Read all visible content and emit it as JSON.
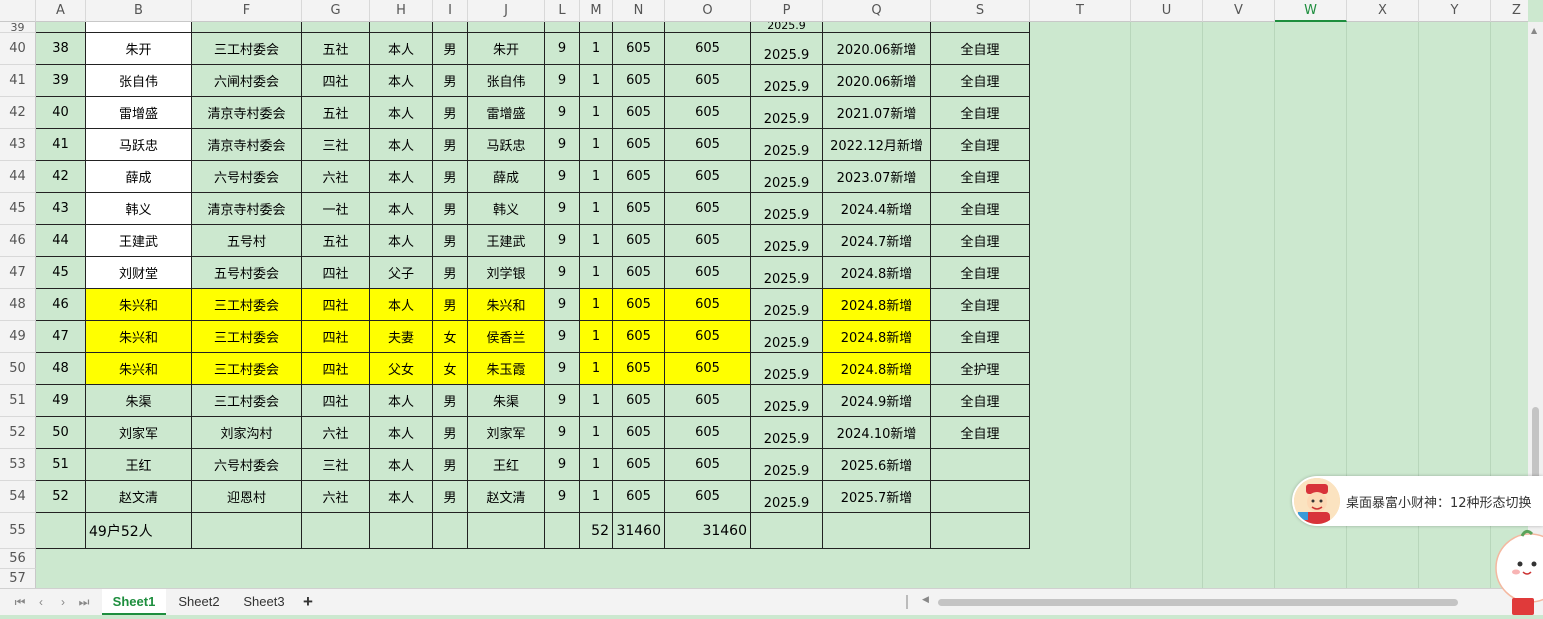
{
  "columns": [
    "A",
    "B",
    "F",
    "G",
    "H",
    "I",
    "J",
    "L",
    "M",
    "N",
    "O",
    "P",
    "Q",
    "S",
    "T",
    "U",
    "V",
    "W",
    "X",
    "Y",
    "Z"
  ],
  "selected_column": "W",
  "rows": [
    {
      "num": "40",
      "a": "38",
      "b": "朱开",
      "f": "三工村委会",
      "g": "五社",
      "h": "本人",
      "i": "男",
      "j": "朱开",
      "l": "9",
      "m": "1",
      "n": "605",
      "o": "605",
      "p": "2025.9",
      "q": "2020.06新增",
      "s": "全自理"
    },
    {
      "num": "41",
      "a": "39",
      "b": "张自伟",
      "f": "六闸村委会",
      "g": "四社",
      "h": "本人",
      "i": "男",
      "j": "张自伟",
      "l": "9",
      "m": "1",
      "n": "605",
      "o": "605",
      "p": "2025.9",
      "q": "2020.06新增",
      "s": "全自理"
    },
    {
      "num": "42",
      "a": "40",
      "b": "雷增盛",
      "f": "清京寺村委会",
      "g": "五社",
      "h": "本人",
      "i": "男",
      "j": "雷增盛",
      "l": "9",
      "m": "1",
      "n": "605",
      "o": "605",
      "p": "2025.9",
      "q": "2021.07新增",
      "s": "全自理"
    },
    {
      "num": "43",
      "a": "41",
      "b": "马跃忠",
      "f": "清京寺村委会",
      "g": "三社",
      "h": "本人",
      "i": "男",
      "j": "马跃忠",
      "l": "9",
      "m": "1",
      "n": "605",
      "o": "605",
      "p": "2025.9",
      "q": "2022.12月新增",
      "s": "全自理"
    },
    {
      "num": "44",
      "a": "42",
      "b": "薛成",
      "f": "六号村委会",
      "g": "六社",
      "h": "本人",
      "i": "男",
      "j": "薛成",
      "l": "9",
      "m": "1",
      "n": "605",
      "o": "605",
      "p": "2025.9",
      "q": "2023.07新增",
      "s": "全自理"
    },
    {
      "num": "45",
      "a": "43",
      "b": "韩义",
      "f": "清京寺村委会",
      "g": "一社",
      "h": "本人",
      "i": "男",
      "j": "韩义",
      "l": "9",
      "m": "1",
      "n": "605",
      "o": "605",
      "p": "2025.9",
      "q": "2024.4新增",
      "s": "全自理"
    },
    {
      "num": "46",
      "a": "44",
      "b": "王建武",
      "f": "五号村",
      "g": "五社",
      "h": "本人",
      "i": "男",
      "j": "王建武",
      "l": "9",
      "m": "1",
      "n": "605",
      "o": "605",
      "p": "2025.9",
      "q": "2024.7新增",
      "s": "全自理"
    },
    {
      "num": "47",
      "a": "45",
      "b": "刘财堂",
      "f": "五号村委会",
      "g": "四社",
      "h": "父子",
      "i": "男",
      "j": "刘学银",
      "l": "9",
      "m": "1",
      "n": "605",
      "o": "605",
      "p": "2025.9",
      "q": "2024.8新增",
      "s": "全自理"
    },
    {
      "num": "48",
      "a": "46",
      "b": "朱兴和",
      "f": "三工村委会",
      "g": "四社",
      "h": "本人",
      "i": "男",
      "j": "朱兴和",
      "l": "9",
      "m": "1",
      "n": "605",
      "o": "605",
      "p": "2025.9",
      "q": "2024.8新增",
      "s": "全自理"
    },
    {
      "num": "49",
      "a": "47",
      "b": "朱兴和",
      "f": "三工村委会",
      "g": "四社",
      "h": "夫妻",
      "i": "女",
      "j": "侯香兰",
      "l": "9",
      "m": "1",
      "n": "605",
      "o": "605",
      "p": "2025.9",
      "q": "2024.8新增",
      "s": "全自理"
    },
    {
      "num": "50",
      "a": "48",
      "b": "朱兴和",
      "f": "三工村委会",
      "g": "四社",
      "h": "父女",
      "i": "女",
      "j": "朱玉霞",
      "l": "9",
      "m": "1",
      "n": "605",
      "o": "605",
      "p": "2025.9",
      "q": "2024.8新增",
      "s": "全护理"
    },
    {
      "num": "51",
      "a": "49",
      "b": "朱渠",
      "f": "三工村委会",
      "g": "四社",
      "h": "本人",
      "i": "男",
      "j": "朱渠",
      "l": "9",
      "m": "1",
      "n": "605",
      "o": "605",
      "p": "2025.9",
      "q": "2024.9新增",
      "s": "全自理"
    },
    {
      "num": "52",
      "a": "50",
      "b": "刘家军",
      "f": "刘家沟村",
      "g": "六社",
      "h": "本人",
      "i": "男",
      "j": "刘家军",
      "l": "9",
      "m": "1",
      "n": "605",
      "o": "605",
      "p": "2025.9",
      "q": "2024.10新增",
      "s": "全自理"
    },
    {
      "num": "53",
      "a": "51",
      "b": "王红",
      "f": "六号村委会",
      "g": "三社",
      "h": "本人",
      "i": "男",
      "j": "王红",
      "l": "9",
      "m": "1",
      "n": "605",
      "o": "605",
      "p": "2025.9",
      "q": "2025.6新增",
      "s": ""
    },
    {
      "num": "54",
      "a": "52",
      "b": "赵文清",
      "f": "迎恩村",
      "g": "六社",
      "h": "本人",
      "i": "男",
      "j": "赵文清",
      "l": "9",
      "m": "1",
      "n": "605",
      "o": "605",
      "p": "2025.9",
      "q": "2025.7新增",
      "s": ""
    }
  ],
  "partial_row": {
    "num": "39",
    "p": "2025.9"
  },
  "total_row": {
    "num": "55",
    "b": "49户52人",
    "m": "52",
    "n": "31460",
    "o": "31460"
  },
  "empty_rows": [
    "56",
    "57"
  ],
  "sheet_tabs": [
    "Sheet1",
    "Sheet2",
    "Sheet3"
  ],
  "active_tab": "Sheet1",
  "add_tab_label": "+",
  "widget_text": "桌面暴富小财神：12种形态切换",
  "colors": {
    "highlight": "#ffff00",
    "eye_care_green": "#cce8cf",
    "active_tab": "#1e8e3e"
  }
}
